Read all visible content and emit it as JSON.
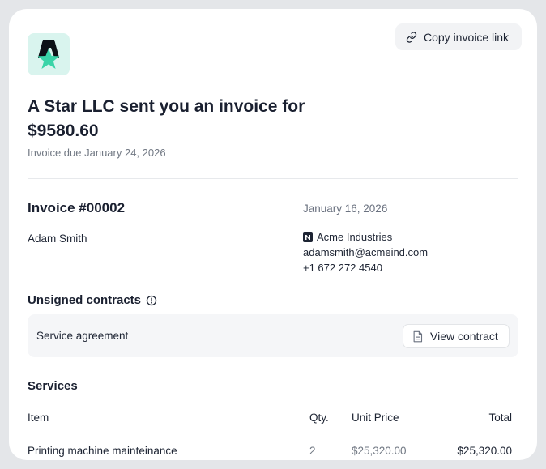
{
  "header": {
    "copy_link_label": "Copy invoice link",
    "logo_icon": "a-star-logo-icon",
    "headline": "A Star LLC sent you an invoice for",
    "amount": "$9580.60",
    "due": "Invoice due January 24, 2026"
  },
  "invoice": {
    "number": "Invoice #00002",
    "date": "January 16, 2026",
    "recipient": "Adam Smith",
    "company": "Acme Industries",
    "email": "adamsmith@acmeind.com",
    "phone": "+1 672 272 4540"
  },
  "contracts": {
    "title": "Unsigned contracts",
    "items": [
      {
        "name": "Service agreement",
        "action": "View contract"
      }
    ]
  },
  "services": {
    "title": "Services",
    "columns": {
      "item": "Item",
      "qty": "Qty.",
      "unit_price": "Unit Price",
      "total": "Total"
    },
    "rows": [
      {
        "item": "Printing machine mainteinance",
        "qty": "2",
        "unit_price": "$25,320.00",
        "total": "$25,320.00"
      }
    ]
  },
  "colors": {
    "accent": "#3ad4a8",
    "logo_bg": "#d9f4ee",
    "text": "#1d2433",
    "muted": "#727984"
  }
}
